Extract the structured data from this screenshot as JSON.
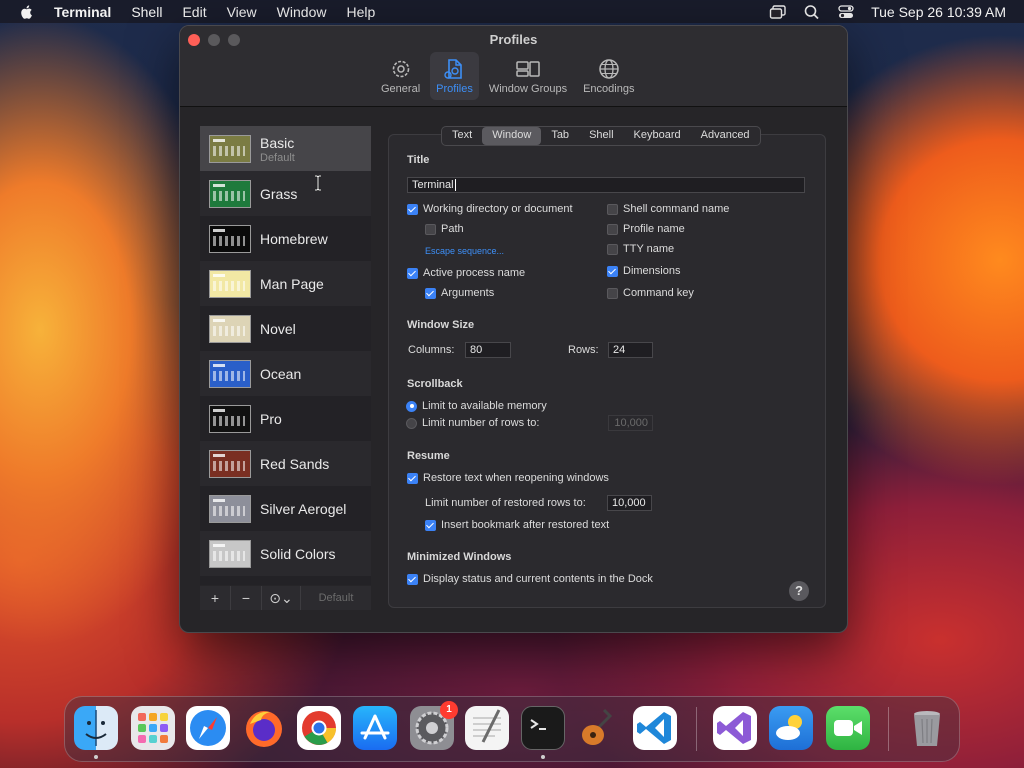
{
  "menubar": {
    "app_name": "Terminal",
    "items": [
      "Shell",
      "Edit",
      "View",
      "Window",
      "Help"
    ],
    "clock": "Tue Sep 26  10:39 AM"
  },
  "window": {
    "title": "Profiles",
    "toolbar": [
      {
        "label": "General",
        "icon": "gear-icon"
      },
      {
        "label": "Profiles",
        "icon": "profiles-icon"
      },
      {
        "label": "Window Groups",
        "icon": "window-groups-icon"
      },
      {
        "label": "Encodings",
        "icon": "globe-icon"
      }
    ],
    "active_toolbar": "Profiles"
  },
  "profiles": {
    "items": [
      {
        "name": "Basic",
        "subtitle": "Default",
        "bg": "#7b7c43",
        "fg": "#ffffff"
      },
      {
        "name": "Grass",
        "bg": "#1e7a3c",
        "fg": "#ffef9e"
      },
      {
        "name": "Homebrew",
        "bg": "#0a0a0a",
        "fg": "#2ee34a"
      },
      {
        "name": "Man Page",
        "bg": "#f2e8a4",
        "fg": "#222222"
      },
      {
        "name": "Novel",
        "bg": "#ddd4b6",
        "fg": "#4a3a2a"
      },
      {
        "name": "Ocean",
        "bg": "#2a5fc9",
        "fg": "#ffffff"
      },
      {
        "name": "Pro",
        "bg": "#111111",
        "fg": "#e0e0e0"
      },
      {
        "name": "Red Sands",
        "bg": "#7a2f22",
        "fg": "#e8c9a0"
      },
      {
        "name": "Silver Aerogel",
        "bg": "#8d8f9a",
        "fg": "#101010"
      },
      {
        "name": "Solid Colors",
        "bg": "#c7c7c7",
        "fg": "#333333"
      }
    ],
    "selected": "Basic",
    "bottom": {
      "add": "+",
      "remove": "−",
      "actions": "⊙⌄",
      "default": "Default"
    }
  },
  "tabs": {
    "items": [
      "Text",
      "Window",
      "Tab",
      "Shell",
      "Keyboard",
      "Advanced"
    ],
    "active": "Window"
  },
  "settings": {
    "title_heading": "Title",
    "title_value": "Terminal",
    "left_options": {
      "working_dir": "Working directory or document",
      "path": "Path",
      "escape": "Escape sequence...",
      "active_process": "Active process name",
      "arguments": "Arguments"
    },
    "right_options": {
      "shell_cmd": "Shell command name",
      "profile_name": "Profile name",
      "tty": "TTY name",
      "dimensions": "Dimensions",
      "command_key": "Command key"
    },
    "window_size_heading": "Window Size",
    "columns_label": "Columns:",
    "columns_value": "80",
    "rows_label": "Rows:",
    "rows_value": "24",
    "scrollback_heading": "Scrollback",
    "limit_memory": "Limit to available memory",
    "limit_rows": "Limit number of rows to:",
    "limit_rows_value": "10,000",
    "resume_heading": "Resume",
    "restore_text": "Restore text when reopening windows",
    "restore_rows_label": "Limit number of restored rows to:",
    "restore_rows_value": "10,000",
    "bookmark": "Insert bookmark after restored text",
    "minimized_heading": "Minimized Windows",
    "dock_status": "Display status and current contents in the Dock",
    "help": "?"
  },
  "dock": {
    "badge": "1"
  }
}
